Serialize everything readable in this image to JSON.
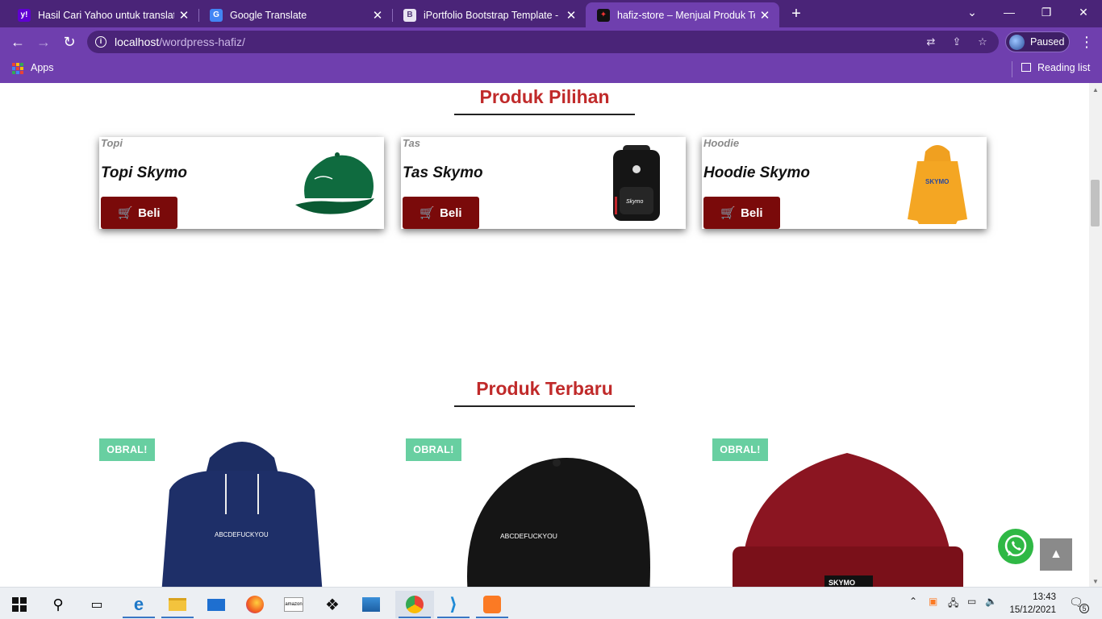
{
  "browser": {
    "tabs": [
      {
        "title": "Hasil Cari Yahoo untuk translate",
        "favicon": "yahoo-icon"
      },
      {
        "title": "Google Translate",
        "favicon": "google-translate-icon"
      },
      {
        "title": "iPortfolio Bootstrap Template - Ind",
        "favicon": "bootstrap-icon"
      },
      {
        "title": "hafiz-store – Menjual Produk Terba",
        "favicon": "store-icon"
      }
    ],
    "active_tab": 3,
    "url_host": "localhost",
    "url_path": "/wordpress-hafiz/",
    "profile_label": "Paused",
    "bookmarks": {
      "apps_label": "Apps",
      "reading_list_label": "Reading list"
    },
    "accent": "#6f3fae"
  },
  "page": {
    "featured": {
      "title": "Produk Pilihan",
      "items": [
        {
          "category": "Topi",
          "name": "Topi Skymo",
          "button": "Beli",
          "image": "green-cap"
        },
        {
          "category": "Tas",
          "name": "Tas Skymo",
          "button": "Beli",
          "image": "black-backpack"
        },
        {
          "category": "Hoodie",
          "name": "Hoodie Skymo",
          "button": "Beli",
          "image": "orange-hoodie"
        }
      ]
    },
    "latest": {
      "title": "Produk Terbaru",
      "items": [
        {
          "badge": "OBRAL!",
          "image": "navy-hoodie",
          "print": "ABCDEFUCKYOU"
        },
        {
          "badge": "OBRAL!",
          "image": "black-cap",
          "print": "ABCDEFUCKYOU"
        },
        {
          "badge": "OBRAL!",
          "image": "maroon-beanie",
          "print": "SKYMO"
        }
      ]
    },
    "colors": {
      "title": "#c02a2a",
      "button": "#7a0a0a",
      "badge": "#68cfa1"
    }
  },
  "taskbar": {
    "apps": [
      "windows-start-icon",
      "search-icon",
      "task-view-icon",
      "edge-icon",
      "file-explorer-icon",
      "mail-icon",
      "firefox-icon",
      "amazon-icon",
      "dropbox-icon",
      "photos-icon",
      "chrome-icon",
      "vscode-icon",
      "xampp-icon"
    ],
    "time": "13:43",
    "date": "15/12/2021",
    "notifications": "5"
  }
}
